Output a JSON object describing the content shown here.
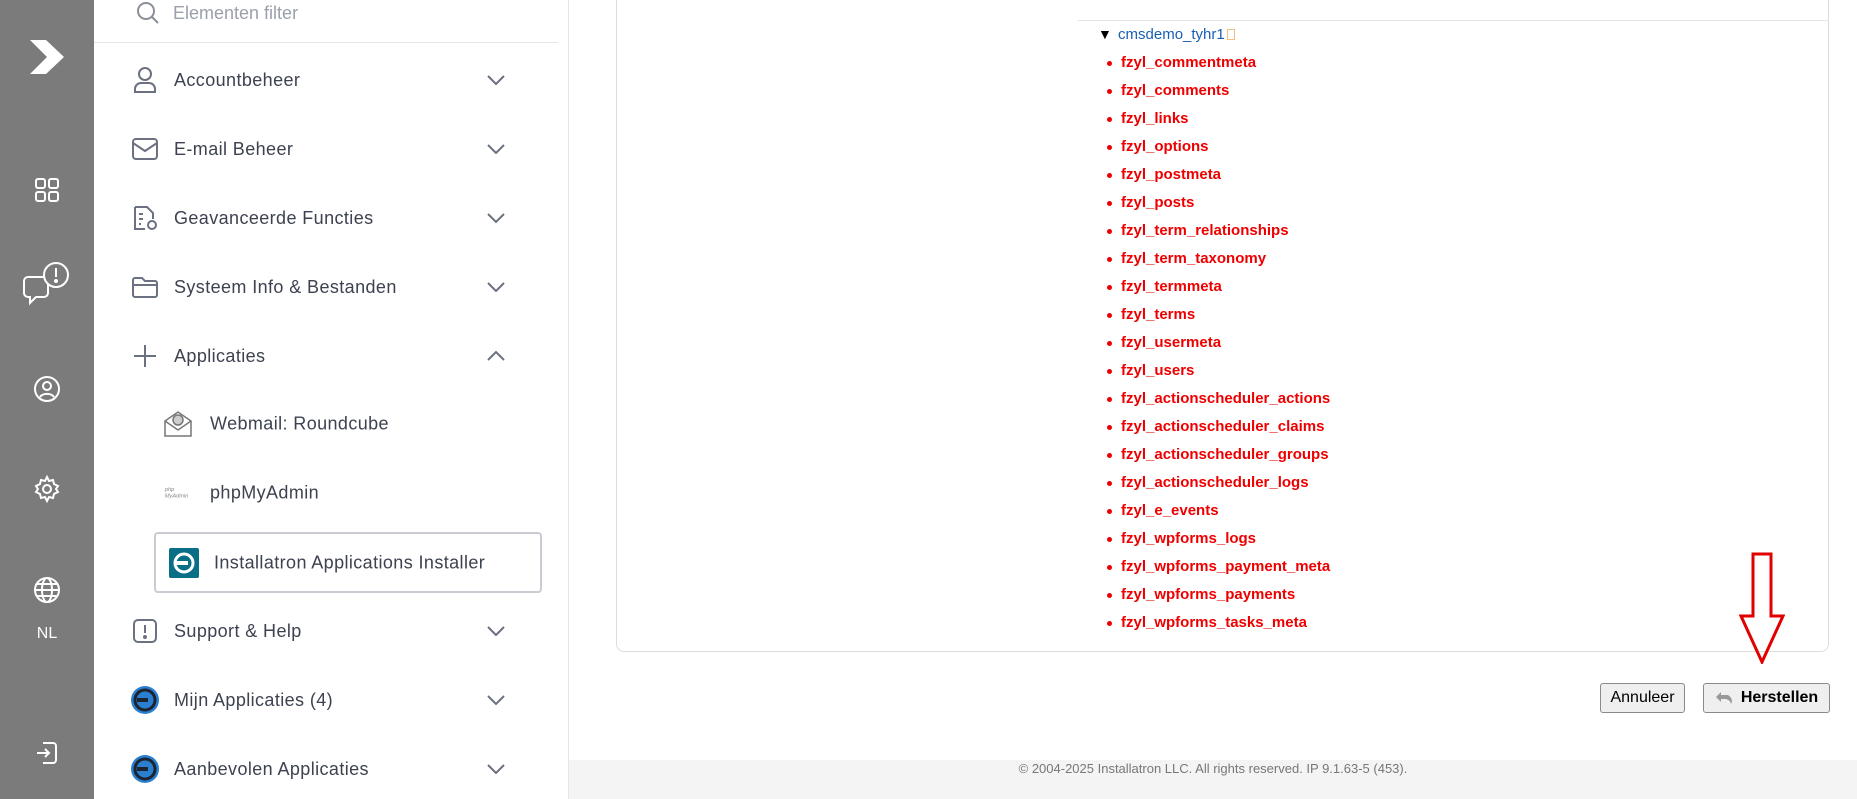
{
  "rail": {
    "items": [
      {
        "icon": "logo-icon"
      },
      {
        "icon": "grid-icon"
      },
      {
        "icon": "chat-alert-icon"
      },
      {
        "icon": "user-circle-icon"
      },
      {
        "icon": "gear-icon"
      },
      {
        "icon": "globe-icon"
      },
      {
        "icon": "logout-icon"
      }
    ],
    "language": "NL"
  },
  "sidebar": {
    "filter_placeholder": "Elementen filter",
    "items": [
      {
        "label": "Accountbeheer",
        "icon": "user-icon"
      },
      {
        "label": "E-mail Beheer",
        "icon": "mail-icon"
      },
      {
        "label": "Geavanceerde Functies",
        "icon": "document-gear-icon"
      },
      {
        "label": "Systeem Info & Bestanden",
        "icon": "folder-icon"
      },
      {
        "label": "Applicaties",
        "icon": "plus-icon"
      },
      {
        "label": "Support & Help",
        "icon": "alert-square-icon"
      },
      {
        "label": "Mijn Applicaties (4)",
        "icon": "installatron-icon"
      },
      {
        "label": "Aanbevolen Applicaties",
        "icon": "installatron-icon"
      }
    ],
    "subitems": [
      {
        "label": "Webmail: Roundcube",
        "icon": "roundcube-icon"
      },
      {
        "label": "phpMyAdmin",
        "icon": "phpmyadmin-icon",
        "icon_text": "php\nMyAdmin"
      },
      {
        "label": "Installatron Applications Installer",
        "icon": "installatron-app-icon"
      }
    ]
  },
  "main": {
    "tree_root": "cmsdemo_tyhr1",
    "tables": [
      "fzyl_commentmeta",
      "fzyl_comments",
      "fzyl_links",
      "fzyl_options",
      "fzyl_postmeta",
      "fzyl_posts",
      "fzyl_term_relationships",
      "fzyl_term_taxonomy",
      "fzyl_termmeta",
      "fzyl_terms",
      "fzyl_usermeta",
      "fzyl_users",
      "fzyl_actionscheduler_actions",
      "fzyl_actionscheduler_claims",
      "fzyl_actionscheduler_groups",
      "fzyl_actionscheduler_logs",
      "fzyl_e_events",
      "fzyl_wpforms_logs",
      "fzyl_wpforms_payment_meta",
      "fzyl_wpforms_payments",
      "fzyl_wpforms_tasks_meta"
    ],
    "cancel_label": "Annuleer",
    "restore_label": "Herstellen",
    "footer": "© 2004-2025 Installatron LLC. All rights reserved. IP 9.1.63-5 (453)."
  },
  "colors": {
    "rail_bg": "#7b7b7b",
    "table_red": "#ee0000",
    "link_blue": "#1a5fb4",
    "annotation_arrow": "#e00000"
  }
}
